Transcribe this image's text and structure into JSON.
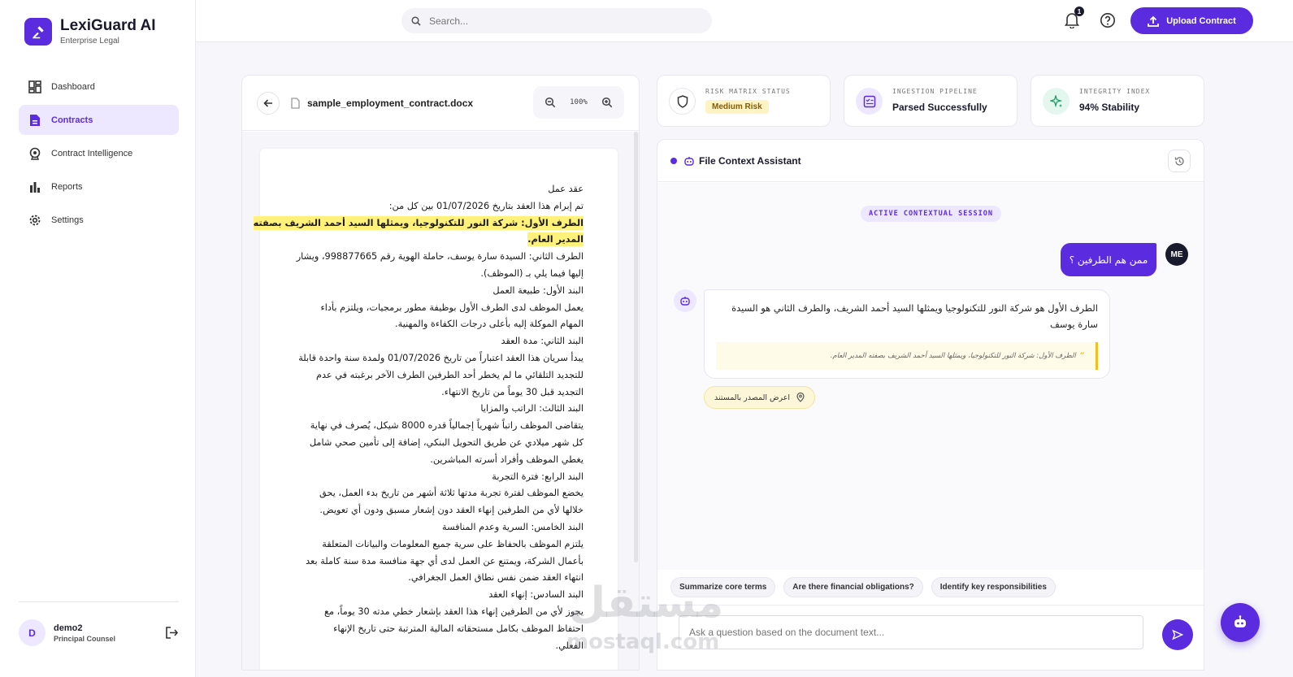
{
  "brand": {
    "title": "LexiGuard AI",
    "subtitle": "Enterprise Legal"
  },
  "sidebar": {
    "items": [
      {
        "label": "Dashboard",
        "icon": "dashboard-icon",
        "active": false
      },
      {
        "label": "Contracts",
        "icon": "document-icon",
        "active": true
      },
      {
        "label": "Contract Intelligence",
        "icon": "intelligence-icon",
        "active": false
      },
      {
        "label": "Reports",
        "icon": "bar-chart-icon",
        "active": false
      },
      {
        "label": "Settings",
        "icon": "gear-icon",
        "active": false
      }
    ],
    "user": {
      "initial": "D",
      "name": "demo2",
      "role": "Principal Counsel"
    }
  },
  "topbar": {
    "search_placeholder": "Search...",
    "notification_count": "1",
    "upload_label": "Upload Contract"
  },
  "document": {
    "file_name": "sample_employment_contract.docx",
    "zoom": "100%",
    "lines": [
      "عقد عمل",
      "تم إبرام هذا العقد بتاريخ 01/07/2026 بين كل من:",
      "الطرف الأول: شركة النور للتكنولوجيا، ويمثلها السيد أحمد الشريف بصفته",
      "المدير العام.",
      "الطرف الثاني: السيدة سارة يوسف، حاملة الهوية رقم 998877665، ويشار",
      "إليها فيما يلي بـ (الموظف).",
      "البند الأول: طبيعة العمل",
      "يعمل الموظف لدى الطرف الأول بوظيفة مطور برمجيات، ويلتزم بأداء",
      "المهام الموكلة إليه بأعلى درجات الكفاءة والمهنية.",
      "البند الثاني: مدة العقد",
      "يبدأ سريان هذا العقد اعتباراً من تاريخ 01/07/2026 ولمدة سنة واحدة قابلة",
      "للتجديد التلقائي ما لم يخطر أحد الطرفين الطرف الآخر برغبته في عدم",
      "التجديد قبل 30 يوماً من تاريخ الانتهاء.",
      "البند الثالث: الراتب والمزايا",
      "يتقاضى الموظف راتباً شهرياً إجمالياً قدره 8000 شيكل، يُصرف في نهاية",
      "كل شهر ميلادي عن طريق التحويل البنكي، إضافة إلى تأمين صحي شامل",
      "يغطي الموظف وأفراد أسرته المباشرين.",
      "البند الرابع: فترة التجربة",
      "يخضع الموظف لفترة تجربة مدتها ثلاثة أشهر من تاريخ بدء العمل، يحق",
      "خلالها لأي من الطرفين إنهاء العقد دون إشعار مسبق ودون أي تعويض.",
      "البند الخامس: السرية وعدم المنافسة",
      "يلتزم الموظف بالحفاظ على سرية جميع المعلومات والبيانات المتعلقة",
      "بأعمال الشركة، ويمتنع عن العمل لدى أي جهة منافسة مدة سنة كاملة بعد",
      "انتهاء العقد ضمن نفس نطاق العمل الجغرافي.",
      "البند السادس: إنهاء العقد",
      "يجوز لأي من الطرفين إنهاء هذا العقد بإشعار خطي مدته 30 يوماً، مع",
      "احتفاظ الموظف بكامل مستحقاته المالية المترتبة حتى تاريخ الإنهاء",
      "الفعلي."
    ]
  },
  "stats": [
    {
      "label": "RISK MATRIX STATUS",
      "value": "Medium Risk",
      "icon": "shield-icon"
    },
    {
      "label": "INGESTION PIPELINE",
      "value": "Parsed Successfully",
      "icon": "checklist-icon"
    },
    {
      "label": "INTEGRITY INDEX",
      "value": "94% Stability",
      "icon": "sparkle-icon"
    }
  ],
  "assistant": {
    "title": "File Context Assistant",
    "session_label": "ACTIVE CONTEXTUAL SESSION",
    "user_avatar": "ME",
    "user_message": "ممن هم الطرفين ؟",
    "bot_message": "الطرف الأول هو شركة النور للتكنولوجيا ويمثلها السيد أحمد الشريف، والطرف الثاني هو السيدة سارة يوسف",
    "quote": "الطرف الأول: شركة النور للتكنولوجيا، ويمثلها السيد أحمد الشريف بصفته المدير العام.",
    "source_button": "اعرض المصدر بالمستند",
    "suggestions": [
      "Summarize core terms",
      "Are there financial obligations?",
      "Identify key responsibilities"
    ],
    "input_placeholder": "Ask a question based on the document text..."
  },
  "watermark": {
    "text": "مستقل",
    "sub": "mostaql.com"
  },
  "colors": {
    "accent": "#5b2be0",
    "highlight": "#fff17a",
    "risk_bg": "#fdf3c4"
  }
}
